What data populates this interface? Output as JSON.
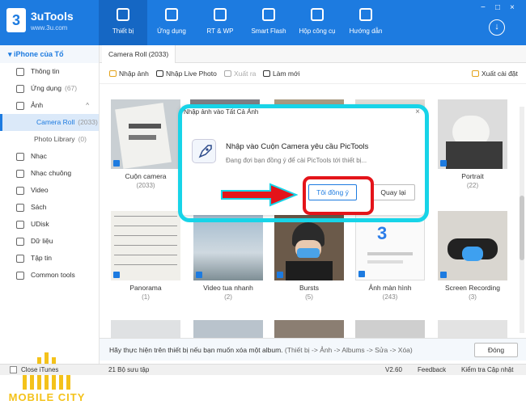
{
  "app": {
    "title": "3uTools",
    "url": "www.3u.com",
    "badge": "3"
  },
  "nav": [
    {
      "label": "Thiết bị",
      "icon": "phone-icon"
    },
    {
      "label": "Ứng dụng",
      "icon": "appstore-icon"
    },
    {
      "label": "RT & WP",
      "icon": "music-icon"
    },
    {
      "label": "Smart Flash",
      "icon": "flash-icon"
    },
    {
      "label": "Hộp công cụ",
      "icon": "toolbox-icon"
    },
    {
      "label": "Hướng dẫn",
      "icon": "graduation-icon"
    }
  ],
  "window_controls": [
    "−",
    "□",
    "×"
  ],
  "sidebar": {
    "device": "iPhone của Tổ",
    "items": [
      {
        "label": "Thông tin",
        "count": ""
      },
      {
        "label": "Ứng dụng",
        "count": "(67)"
      },
      {
        "label": "Ảnh",
        "count": ""
      },
      {
        "label": "Camera Roll",
        "count": "(2033)"
      },
      {
        "label": "Photo Library",
        "count": "(0)"
      },
      {
        "label": "Nhạc",
        "count": ""
      },
      {
        "label": "Nhạc chuông",
        "count": ""
      },
      {
        "label": "Video",
        "count": ""
      },
      {
        "label": "Sách",
        "count": ""
      },
      {
        "label": "UDisk",
        "count": ""
      },
      {
        "label": "Dữ liệu",
        "count": ""
      },
      {
        "label": "Tập tin",
        "count": ""
      },
      {
        "label": "Common tools",
        "count": ""
      }
    ],
    "watermark": "MOBILE CITY"
  },
  "tab": "Camera Roll (2033)",
  "toolbar": {
    "import_photo": "Nhập ảnh",
    "import_live": "Nhập Live Photo",
    "export": "Xuất ra",
    "refresh": "Làm mới",
    "settings": "Xuất cài đặt"
  },
  "albums": [
    {
      "name": "Cuộn camera",
      "count": "(2033)"
    },
    {
      "name": "",
      "count": ""
    },
    {
      "name": "",
      "count": ""
    },
    {
      "name": "",
      "count": ""
    },
    {
      "name": "Portrait",
      "count": "(22)"
    },
    {
      "name": "Panorama",
      "count": "(1)"
    },
    {
      "name": "Video tua nhanh",
      "count": "(2)"
    },
    {
      "name": "Bursts",
      "count": "(5)"
    },
    {
      "name": "Ảnh màn hình",
      "count": "(243)"
    },
    {
      "name": "Screen Recording",
      "count": "(3)"
    }
  ],
  "footer": {
    "text": "Hãy thực hiện trên thiết bị nếu bạn muốn xóa một album.",
    "path": "(Thiết bị -> Ảnh -> Albums -> Sửa -> Xóa)",
    "close": "Đóng"
  },
  "status": {
    "close_itunes": "Close iTunes",
    "collections": "21 Bộ sưu tập",
    "version": "V2.60",
    "feedback": "Feedback",
    "update": "Kiểm tra Cập nhật"
  },
  "dialog": {
    "title": "Nhập ảnh vào Tất Cả Ảnh",
    "close": "×",
    "heading": "Nhập vào Cuộn Camera yêu cầu PicTools",
    "sub": "Đang đợi bạn đồng ý để cài PicTools tới thiết bị...",
    "ok": "Tôi đồng ý",
    "cancel": "Quay lại"
  },
  "colors": {
    "brand": "#1d7be0",
    "highlight_frame": "#17d4e8",
    "red_mark": "#e4141a",
    "watermark": "#f4c21a"
  }
}
